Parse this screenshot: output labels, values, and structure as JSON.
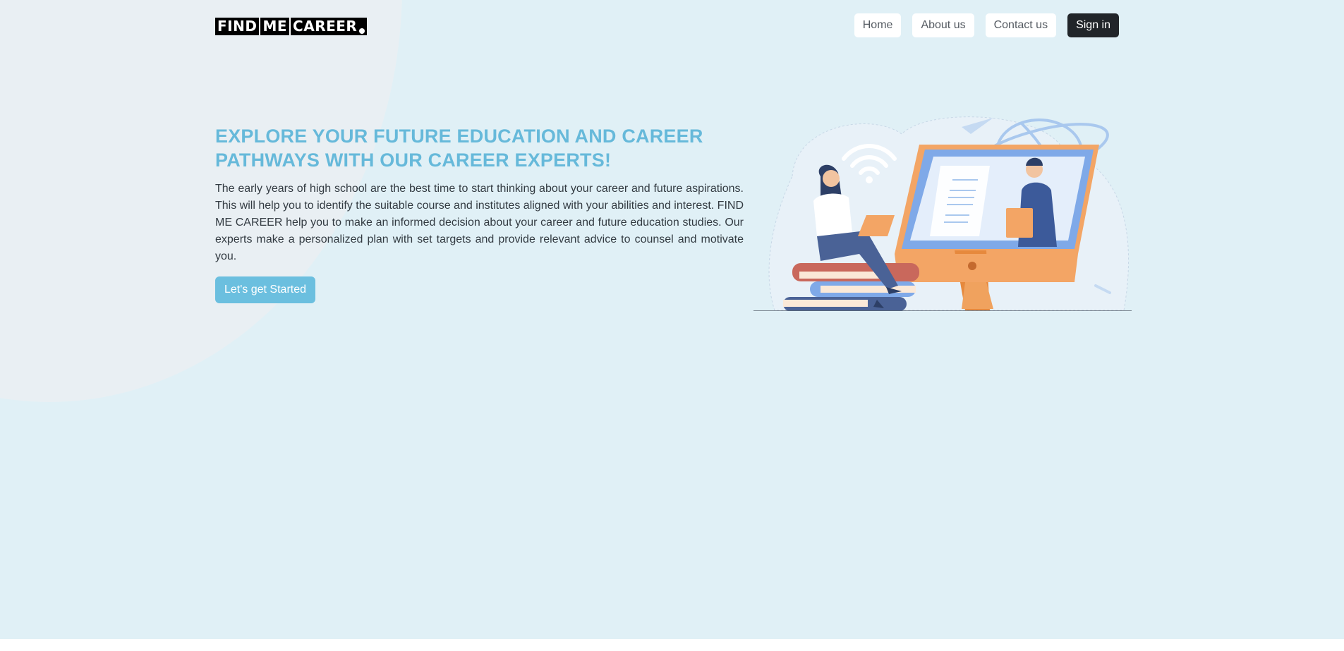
{
  "brand": {
    "logo_parts": [
      "FIND",
      "ME",
      "CAREER"
    ]
  },
  "nav": {
    "home": "Home",
    "about": "About us",
    "contact": "Contact us",
    "signin": "Sign in"
  },
  "hero": {
    "title": "EXPLORE YOUR FUTURE EDUCATION AND CAREER PATHWAYS WITH OUR CAREER EXPERTS!",
    "description": "The early years of high school are the best time to start thinking about your career and future aspirations. This will help you to identify the suitable course and institutes aligned with your abilities and interest. FIND ME CAREER help you to make an informed decision about your career and future education studies. Our experts make a personalized plan with set targets and provide relevant advice to counsel and motivate you.",
    "cta_label": "Let's get Started"
  },
  "colors": {
    "page_background": "#e0f0f6",
    "accent": "#66b9da",
    "signin_background": "#212529"
  },
  "icons": {
    "illustration": "career-counselling-illustration"
  }
}
